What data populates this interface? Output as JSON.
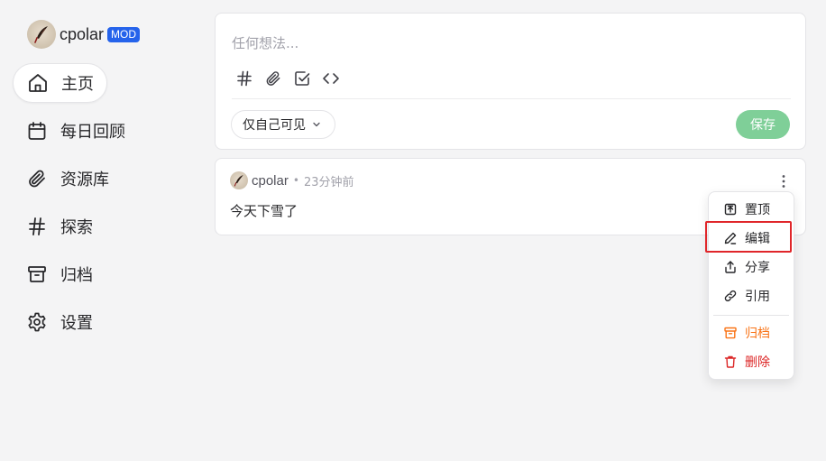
{
  "brand": {
    "name": "cpolar",
    "badge": "MOD"
  },
  "sidebar": {
    "items": [
      {
        "label": "主页",
        "icon": "home-icon",
        "active": true
      },
      {
        "label": "每日回顾",
        "icon": "calendar-icon"
      },
      {
        "label": "资源库",
        "icon": "paperclip-icon"
      },
      {
        "label": "探索",
        "icon": "hash-icon"
      },
      {
        "label": "归档",
        "icon": "archive-icon"
      },
      {
        "label": "设置",
        "icon": "gear-icon"
      }
    ]
  },
  "editor": {
    "placeholder": "任何想法...",
    "tools": [
      "hash-icon",
      "paperclip-icon",
      "checkbox-icon",
      "code-icon"
    ],
    "visibility": "仅自己可见",
    "save_label": "保存"
  },
  "memo": {
    "user": "cpolar",
    "time": "23分钟前",
    "content": "今天下雪了"
  },
  "menu": {
    "items": [
      {
        "label": "置顶",
        "icon": "pin-icon"
      },
      {
        "label": "编辑",
        "icon": "pencil-icon",
        "highlighted": true
      },
      {
        "label": "分享",
        "icon": "share-icon"
      },
      {
        "label": "引用",
        "icon": "link-icon"
      },
      {
        "label": "归档",
        "icon": "archive-icon",
        "style": "warning"
      },
      {
        "label": "删除",
        "icon": "trash-icon",
        "style": "danger"
      }
    ]
  },
  "colors": {
    "background": "#f4f4f5",
    "brand_badge": "#2563eb",
    "save_button": "#7fcf98",
    "archive_text": "#f97316",
    "delete_text": "#dc2626",
    "highlight_box": "#e0262a"
  }
}
